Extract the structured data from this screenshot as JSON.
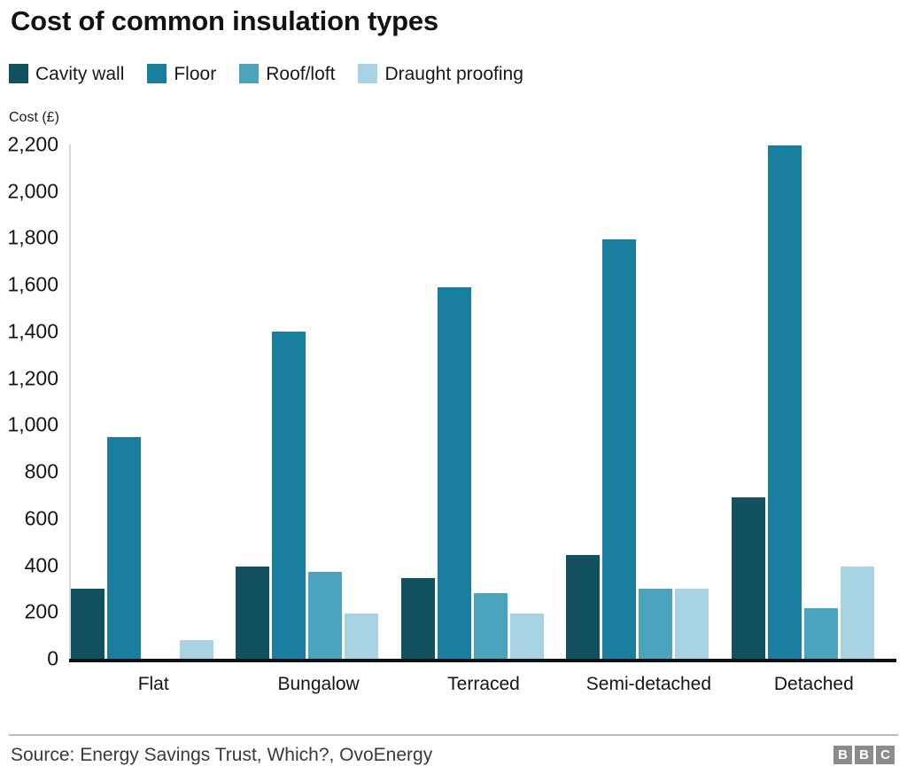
{
  "title": "Cost of common insulation types",
  "y_axis_caption": "Cost (£)",
  "legend": [
    {
      "label": "Cavity wall",
      "color": "#115160"
    },
    {
      "label": "Floor",
      "color": "#1a7f9e"
    },
    {
      "label": "Roof/loft",
      "color": "#4ba3bd"
    },
    {
      "label": "Draught proofing",
      "color": "#a8d3e2"
    }
  ],
  "y_ticks": [
    "2,200",
    "2,000",
    "1,800",
    "1,600",
    "1,400",
    "1,200",
    "1,000",
    "800",
    "600",
    "400",
    "200",
    "0"
  ],
  "footer": {
    "source": "Source: Energy Savings Trust, Which?, OvoEnergy",
    "logo": [
      "B",
      "B",
      "C"
    ]
  },
  "chart_data": {
    "type": "bar",
    "title": "Cost of common insulation types",
    "xlabel": "",
    "ylabel": "Cost (£)",
    "ylim": [
      0,
      2200
    ],
    "ytick_step": 200,
    "grid": false,
    "legend_position": "top-left",
    "categories": [
      "Flat",
      "Bungalow",
      "Terraced",
      "Semi-detached",
      "Detached"
    ],
    "series": [
      {
        "name": "Cavity wall",
        "color": "#115160",
        "values": [
          300,
          395,
          345,
          445,
          690
        ]
      },
      {
        "name": "Floor",
        "color": "#1a7f9e",
        "values": [
          950,
          1400,
          1590,
          1795,
          2195
        ]
      },
      {
        "name": "Roof/loft",
        "color": "#4ba3bd",
        "values": [
          null,
          370,
          280,
          300,
          215
        ]
      },
      {
        "name": "Draught proofing",
        "color": "#a8d3e2",
        "values": [
          80,
          195,
          195,
          300,
          395
        ]
      }
    ]
  }
}
